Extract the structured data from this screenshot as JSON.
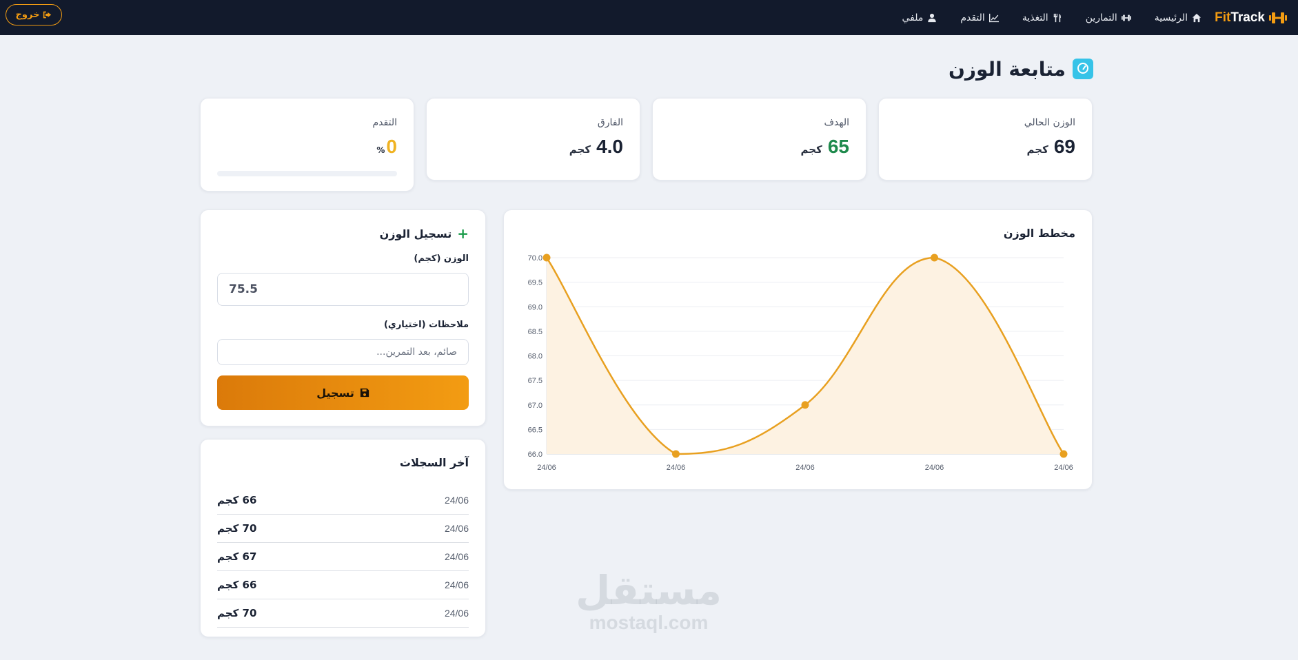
{
  "brand": {
    "fit": "Fit",
    "track": "Track",
    "icon": "dumbbell-icon"
  },
  "nav": {
    "items": [
      {
        "label": "الرئيسية",
        "icon": "home-icon"
      },
      {
        "label": "التمارين",
        "icon": "dumbbell-icon"
      },
      {
        "label": "التغذية",
        "icon": "utensils-icon"
      },
      {
        "label": "التقدم",
        "icon": "chart-line-icon"
      },
      {
        "label": "ملفي",
        "icon": "user-icon"
      }
    ],
    "logout": {
      "label": "خروج",
      "icon": "sign-out-icon"
    }
  },
  "page": {
    "title": "متابعة الوزن",
    "icon": "weight-scale-icon"
  },
  "stats": {
    "current": {
      "label": "الوزن الحالي",
      "value": "69",
      "unit": "كجم",
      "color": "#1a2233"
    },
    "goal": {
      "label": "الهدف",
      "value": "65",
      "unit": "كجم",
      "color": "#1e8a4c"
    },
    "diff": {
      "label": "الفارق",
      "value": "4.0",
      "unit": "كجم",
      "color": "#1a2233"
    },
    "progress": {
      "label": "التقدم",
      "value": "0",
      "unit": "%",
      "percent": 0,
      "color": "#f0b323"
    }
  },
  "chart": {
    "title": "مخطط الوزن",
    "line_color": "#e8a020",
    "fill_color": "#fdf2e2"
  },
  "chart_data": {
    "type": "line",
    "x": [
      "24/06",
      "24/06",
      "24/06",
      "24/06",
      "24/06"
    ],
    "values": [
      70,
      66,
      67,
      70,
      66
    ],
    "ylim": [
      66,
      70
    ],
    "yticks": [
      "70.0",
      "69.5",
      "69.0",
      "68.5",
      "68.0",
      "67.5",
      "67.0",
      "66.5",
      "66.0"
    ],
    "grid": true,
    "title": "",
    "xlabel": "",
    "ylabel": ""
  },
  "form": {
    "title": "تسجيل الوزن",
    "weight_label": "الوزن (كجم)",
    "weight_value": "75.5",
    "notes_label": "ملاحظات (اختياري)",
    "notes_placeholder": "صائم، بعد التمرين...",
    "submit_label": "تسجيل",
    "submit_icon": "save-icon"
  },
  "records": {
    "title": "آخر السجلات",
    "items": [
      {
        "date": "24/06",
        "weight": "66 كجم"
      },
      {
        "date": "24/06",
        "weight": "70 كجم"
      },
      {
        "date": "24/06",
        "weight": "67 كجم"
      },
      {
        "date": "24/06",
        "weight": "66 كجم"
      },
      {
        "date": "24/06",
        "weight": "70 كجم"
      }
    ]
  },
  "watermark": {
    "arabic": "مستقل",
    "latin": "mostaql.com"
  }
}
